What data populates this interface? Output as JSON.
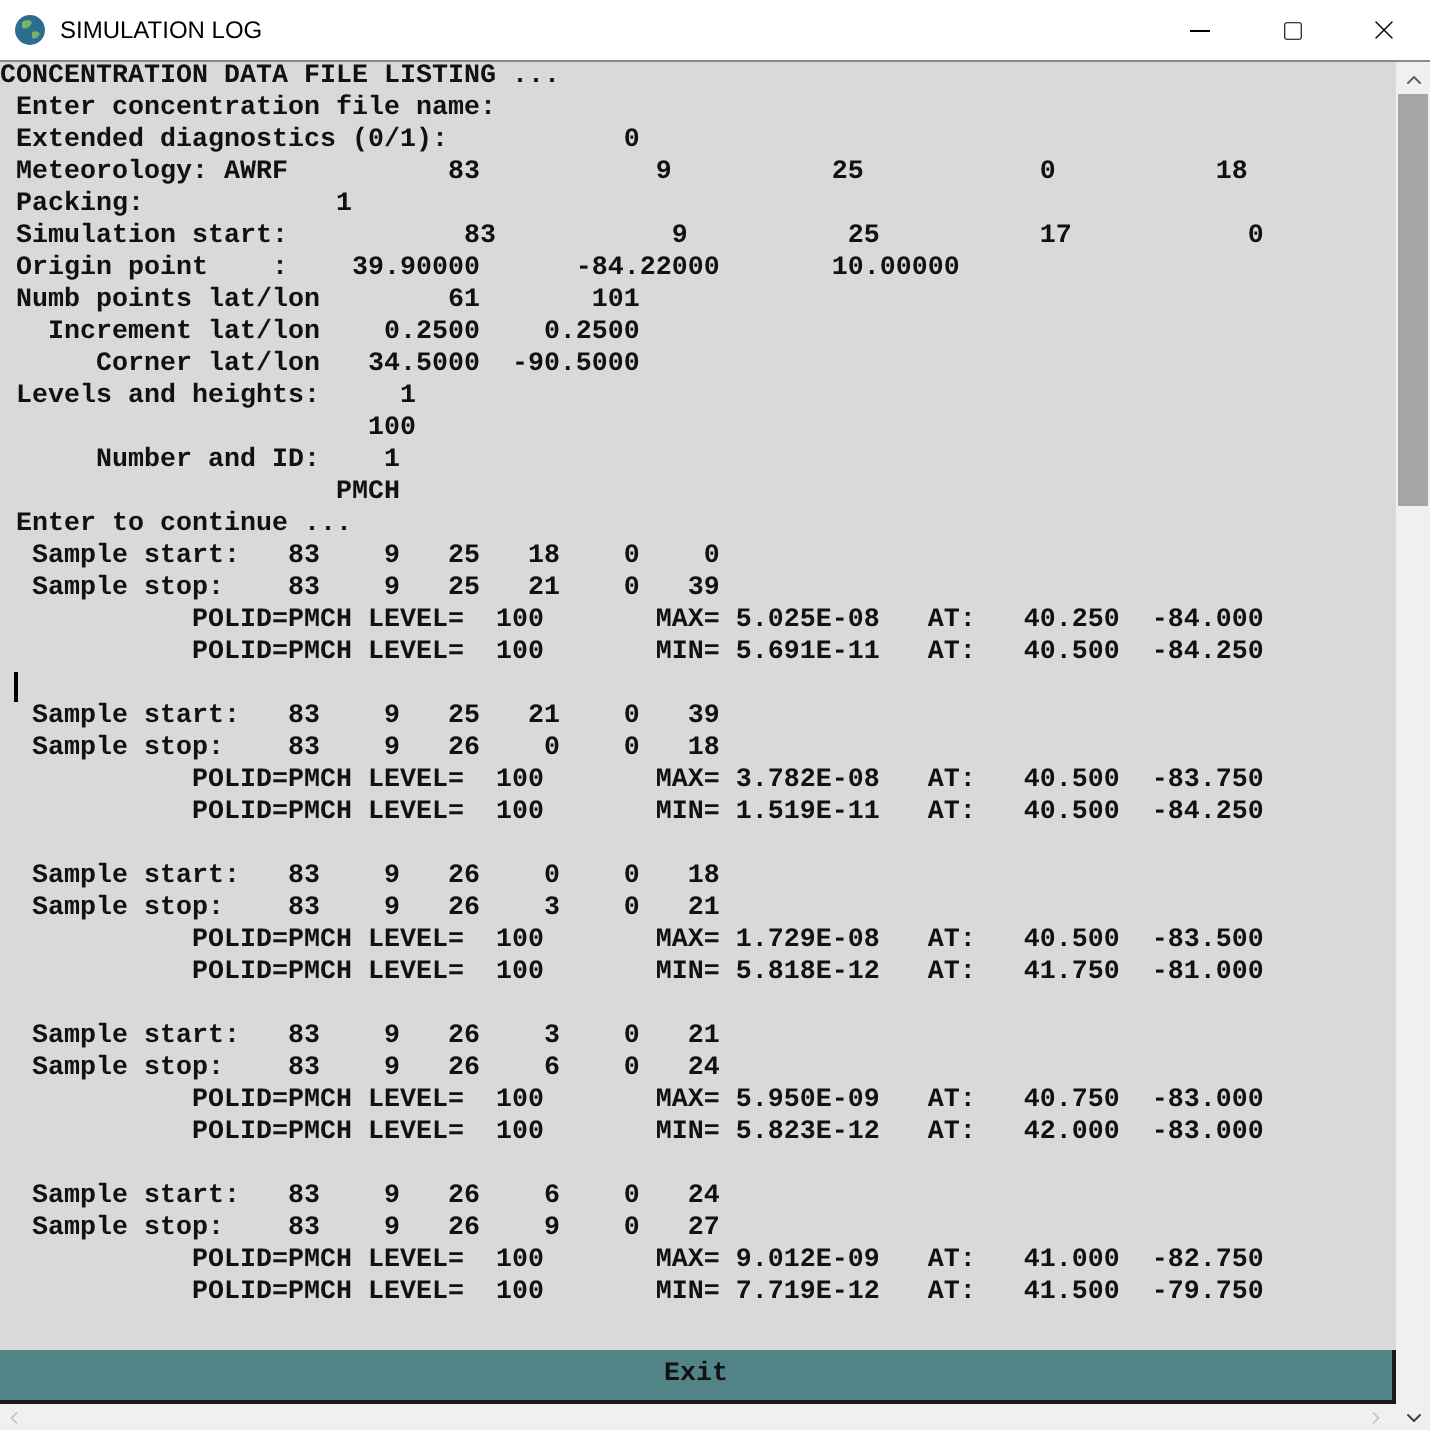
{
  "window": {
    "title": "SIMULATION LOG"
  },
  "header_lines": [
    "CONCENTRATION DATA FILE LISTING ...",
    " Enter concentration file name:",
    " Extended diagnostics (0/1):           0",
    " Meteorology: AWRF          83           9          25           0          18",
    " Packing:            1",
    " Simulation start:           83           9          25          17           0",
    " Origin point    :    39.90000      -84.22000       10.00000",
    " Numb points lat/lon        61       101",
    "   Increment lat/lon    0.2500    0.2500",
    "      Corner lat/lon   34.5000  -90.5000",
    " Levels and heights:     1",
    "                       100",
    "      Number and ID:    1",
    "                     PMCH",
    " Enter to continue ..."
  ],
  "blocks": [
    {
      "cursor_after": true,
      "lines": [
        "  Sample start:   83    9   25   18    0    0",
        "  Sample stop:    83    9   25   21    0   39",
        "            POLID=PMCH LEVEL=  100       MAX= 5.025E-08   AT:   40.250  -84.000",
        "            POLID=PMCH LEVEL=  100       MIN= 5.691E-11   AT:   40.500  -84.250"
      ]
    },
    {
      "cursor_after": false,
      "lines": [
        "  Sample start:   83    9   25   21    0   39",
        "  Sample stop:    83    9   26    0    0   18",
        "            POLID=PMCH LEVEL=  100       MAX= 3.782E-08   AT:   40.500  -83.750",
        "            POLID=PMCH LEVEL=  100       MIN= 1.519E-11   AT:   40.500  -84.250"
      ]
    },
    {
      "cursor_after": false,
      "lines": [
        "  Sample start:   83    9   26    0    0   18",
        "  Sample stop:    83    9   26    3    0   21",
        "            POLID=PMCH LEVEL=  100       MAX= 1.729E-08   AT:   40.500  -83.500",
        "            POLID=PMCH LEVEL=  100       MIN= 5.818E-12   AT:   41.750  -81.000"
      ]
    },
    {
      "cursor_after": false,
      "lines": [
        "  Sample start:   83    9   26    3    0   21",
        "  Sample stop:    83    9   26    6    0   24",
        "            POLID=PMCH LEVEL=  100       MAX= 5.950E-09   AT:   40.750  -83.000",
        "            POLID=PMCH LEVEL=  100       MIN= 5.823E-12   AT:   42.000  -83.000"
      ]
    },
    {
      "cursor_after": false,
      "lines": [
        "  Sample start:   83    9   26    6    0   24",
        "  Sample stop:    83    9   26    9    0   27",
        "            POLID=PMCH LEVEL=  100       MAX= 9.012E-09   AT:   41.000  -82.750",
        "            POLID=PMCH LEVEL=  100       MIN= 7.719E-12   AT:   41.500  -79.750"
      ]
    }
  ],
  "exit_button": "Exit"
}
